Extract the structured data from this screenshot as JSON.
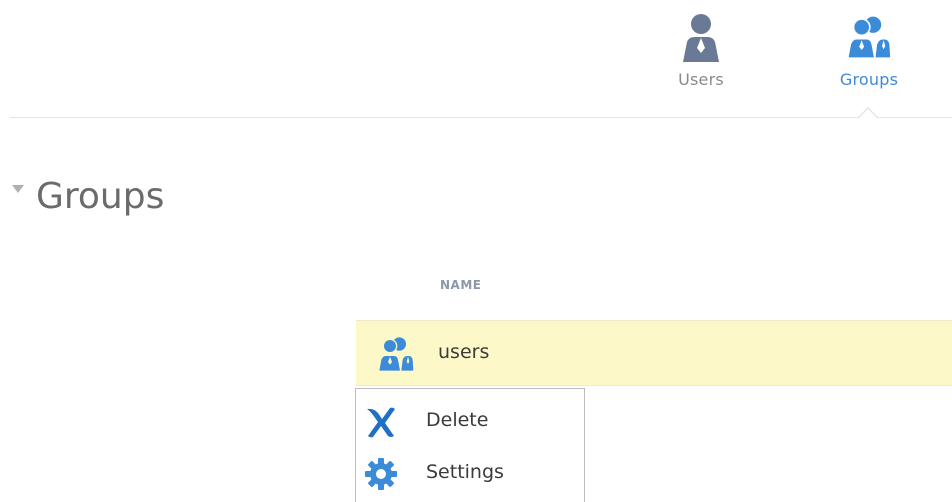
{
  "nav": {
    "items": [
      {
        "label": "Users",
        "icon": "user-icon",
        "color": "#6a7a96",
        "active": false
      },
      {
        "label": "Groups",
        "icon": "group-icon",
        "color": "#3c8bd9",
        "active": true
      }
    ]
  },
  "section": {
    "title": "Groups",
    "expanded": true
  },
  "table": {
    "columns": [
      "NAME"
    ],
    "rows": [
      {
        "name": "users",
        "icon": "group-icon",
        "selected": true
      }
    ]
  },
  "context_menu": {
    "items": [
      {
        "label": "Delete",
        "icon": "delete-x-icon"
      },
      {
        "label": "Settings",
        "icon": "gear-icon"
      }
    ]
  },
  "colors": {
    "accent": "#3c8bd9",
    "selected_row": "#fcf8c8",
    "muted_icon": "#6a7a96"
  }
}
